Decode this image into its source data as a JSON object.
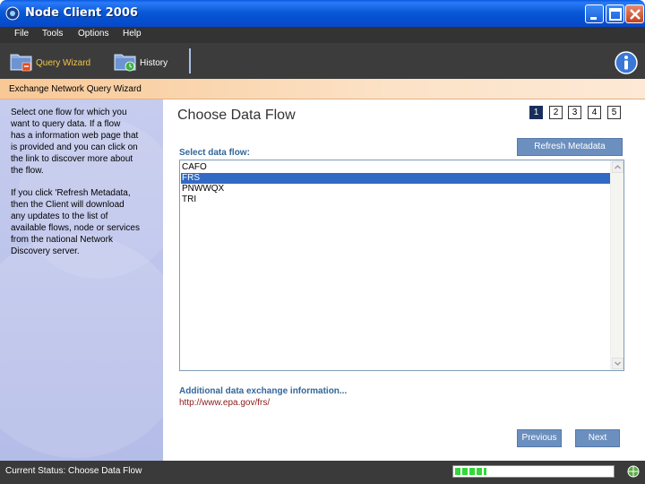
{
  "window": {
    "title": "Node Client 2006"
  },
  "menu": {
    "items": [
      "File",
      "Tools",
      "Options",
      "Help"
    ]
  },
  "toolbar": {
    "query_wizard_label": "Query Wizard",
    "history_label": "History",
    "query_wizard_color": "#f4c542"
  },
  "wizard": {
    "header": "Exchange Network Query Wizard"
  },
  "help": {
    "para1_lines": [
      "Select one flow for which you",
      "want to query data. If a flow",
      "has a information web page that",
      "is provided and you can click on",
      "the link to discover more about",
      "the flow."
    ],
    "para2_lines": [
      "If you click 'Refresh Metadata,",
      "then the Client will download",
      "any updates to the list of",
      "available flows, node or services",
      "from the national Network",
      "Discovery server."
    ]
  },
  "main": {
    "title": "Choose Data Flow",
    "steps": [
      "1",
      "2",
      "3",
      "4",
      "5"
    ],
    "active_step": "1",
    "refresh_label": "Refresh Metadata",
    "select_label": "Select data flow:",
    "flows": [
      "CAFO",
      "FRS",
      "PNWWQX",
      "TRI"
    ],
    "selected_flow": "FRS",
    "additional_label": "Additional data exchange information...",
    "additional_link": "http://www.epa.gov/frs/",
    "previous_label": "Previous",
    "next_label": "Next"
  },
  "status": {
    "text": "Current Status:  Choose Data Flow",
    "progress_fraction": 0.2
  },
  "colors": {
    "accent_button": "#6b8fbf",
    "selection": "#316ac5",
    "label_blue": "#336699",
    "link_red": "#8b1a1a"
  }
}
